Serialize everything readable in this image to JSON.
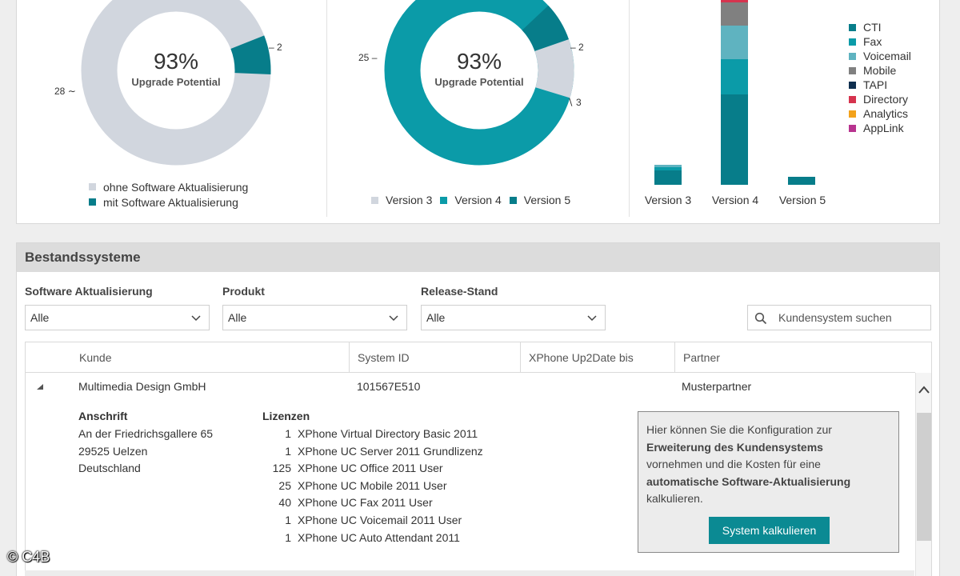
{
  "colors": {
    "teal_dark": "#077d8a",
    "teal_main": "#0b9ba8",
    "teal_light": "#5fb3c0",
    "grey_light": "#d1d6de",
    "mobile_grey": "#808080",
    "tapi_navy": "#0f2f4f",
    "directory_red": "#d6334e",
    "analytics_orange": "#f3a21b",
    "applink_magenta": "#b8338f",
    "button_teal": "#0b8a93"
  },
  "donut1": {
    "percent": "93%",
    "label": "Upgrade Potential",
    "callout_large": "28",
    "callout_small": "2",
    "legend": [
      "ohne Software Aktualisierung",
      "mit Software Aktualisierung"
    ]
  },
  "donut2": {
    "percent": "93%",
    "label": "Upgrade Potential",
    "callout_v4": "25",
    "callout_v5": "2",
    "callout_v3": "3",
    "legend": [
      "Version 3",
      "Version 4",
      "Version 5"
    ]
  },
  "chart_data": [
    {
      "type": "pie",
      "labels": [
        "ohne Software Aktualisierung",
        "mit Software Aktualisierung"
      ],
      "values": [
        28,
        2
      ],
      "center_text": "93% Upgrade Potential"
    },
    {
      "type": "pie",
      "labels": [
        "Version 3",
        "Version 4",
        "Version 5"
      ],
      "values": [
        3,
        25,
        2
      ],
      "center_text": "93% Upgrade Potential"
    },
    {
      "type": "bar",
      "stacked": true,
      "categories": [
        "Version 3",
        "Version 4",
        "Version 5"
      ],
      "legend_entries": [
        "CTI",
        "Fax",
        "Voicemail",
        "Mobile",
        "TAPI",
        "Directory",
        "Analytics",
        "AppLink"
      ]
    }
  ],
  "stack_legend": [
    "CTI",
    "Fax",
    "Voicemail",
    "Mobile",
    "TAPI",
    "Directory",
    "Analytics",
    "AppLink"
  ],
  "bar_labels": [
    "Version 3",
    "Version 4",
    "Version 5"
  ],
  "section": {
    "title": "Bestandssysteme",
    "filters": [
      {
        "label": "Software Aktualisierung",
        "value": "Alle"
      },
      {
        "label": "Produkt",
        "value": "Alle"
      },
      {
        "label": "Release-Stand",
        "value": "Alle"
      }
    ],
    "search_placeholder": "Kundensystem suchen"
  },
  "table": {
    "columns": [
      "Kunde",
      "System ID",
      "XPhone Up2Date bis",
      "Partner"
    ],
    "row": {
      "kunde": "Multimedia Design GmbH",
      "system_id": "101567E510",
      "up2date": "",
      "partner": "Musterpartner"
    }
  },
  "detail": {
    "address_title": "Anschrift",
    "address": [
      "An der Friedrichsgallere 65",
      "29525  Uelzen",
      "Deutschland"
    ],
    "licenses_title": "Lizenzen",
    "licenses": [
      {
        "qty": "1",
        "name": "XPhone Virtual Directory Basic 2011"
      },
      {
        "qty": "1",
        "name": "XPhone UC Server 2011 Grundlizenz"
      },
      {
        "qty": "125",
        "name": "XPhone UC Office 2011 User"
      },
      {
        "qty": "25",
        "name": "XPhone UC Mobile 2011 User"
      },
      {
        "qty": "40",
        "name": "XPhone UC Fax 2011 User"
      },
      {
        "qty": "1",
        "name": "XPhone UC Voicemail 2011 User"
      },
      {
        "qty": "1",
        "name": "XPhone UC Auto Attendant 2011"
      }
    ]
  },
  "info": {
    "t1": "Hier können Sie die Konfiguration zur",
    "b1": "Erweiterung des Kundensystems",
    "t2": "vornehmen und die Kosten für eine",
    "b2": "automatische Software-Aktualisierung",
    "t3": "kalkulieren.",
    "button": "System kalkulieren"
  },
  "copyright": "© C4B"
}
